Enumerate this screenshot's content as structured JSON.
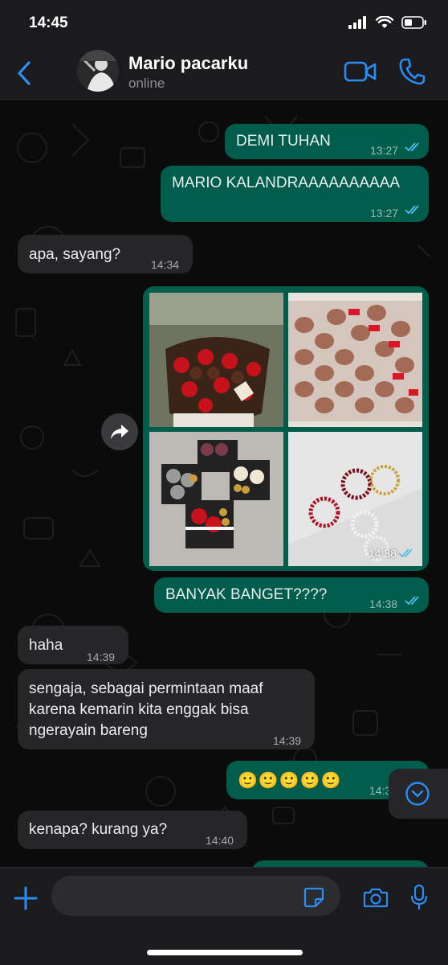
{
  "status_bar": {
    "time": "14:45"
  },
  "header": {
    "contact_name": "Mario pacarku",
    "contact_status": "online"
  },
  "messages": [
    {
      "direction": "out",
      "text": "DEMI TUHAN",
      "time": "13:27",
      "read": true
    },
    {
      "direction": "out",
      "text": "MARIO KALANDRAAAAAAAAAA",
      "time": "13:27",
      "read": true
    },
    {
      "direction": "in",
      "text": "apa, sayang?",
      "time": "14:34"
    },
    {
      "direction": "in",
      "type": "album",
      "photos": [
        "chocolate strawberry bouquet",
        "chocolate strawberries box",
        "flower and chocolate gift boxes",
        "beaded rings"
      ],
      "time": "14:38",
      "read": true
    },
    {
      "direction": "out",
      "text": "BANYAK BANGET????",
      "time": "14:38",
      "read": true
    },
    {
      "direction": "in",
      "text": "haha",
      "time": "14:39"
    },
    {
      "direction": "in",
      "lines": [
        "sengaja, sebagai permintaan maaf",
        "karena kemarin kita enggak bisa",
        "ngerayain bareng"
      ],
      "time": "14:39"
    },
    {
      "direction": "out",
      "text": "🙂🙂🙂🙂🙂",
      "time": "14:3"
    },
    {
      "direction": "in",
      "text": "kenapa? kurang ya?",
      "time": "14:40"
    }
  ],
  "composer": {
    "placeholder": ""
  },
  "icons": {
    "back": "chevron-left-icon",
    "video": "video-camera-icon",
    "call": "phone-icon",
    "forward": "forward-arrow-icon",
    "scroll": "chevron-down-circle-icon",
    "attach": "plus-icon",
    "sticker": "sticker-icon",
    "camera": "camera-icon",
    "mic": "microphone-icon"
  },
  "colors": {
    "accent": "#2a8cf5",
    "outgoing_bubble": "#005c4b",
    "incoming_bubble": "#262628",
    "read_ticks": "#53bdeb"
  }
}
